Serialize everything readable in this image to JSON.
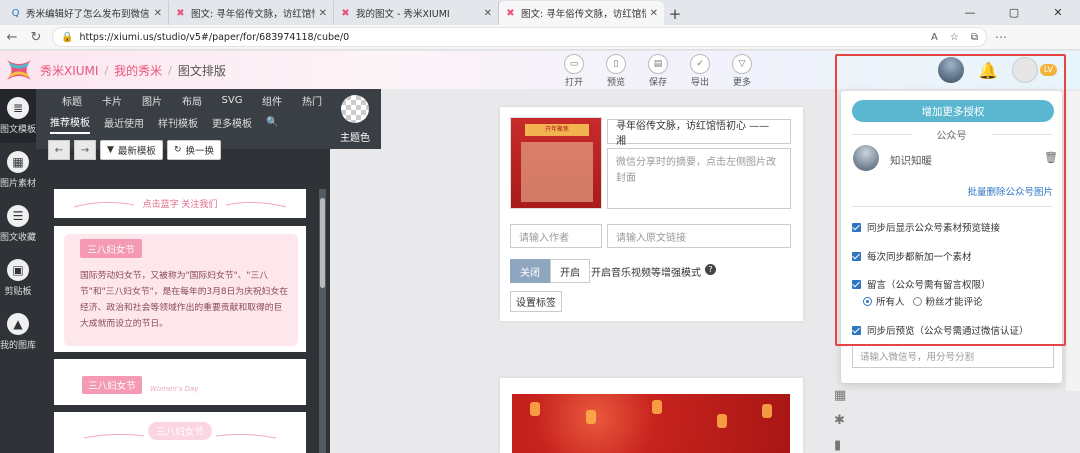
{
  "browser": {
    "tabs": [
      {
        "label": "秀米编辑好了怎么发布到微信公众号",
        "icon": "search-icon",
        "active": false
      },
      {
        "label": "图文: 寻年俗传文脉，访红馆悟初心",
        "icon": "xiumi-logo-icon",
        "active": false
      },
      {
        "label": "我的图文 - 秀米XIUMI",
        "icon": "xiumi-logo-icon",
        "active": false
      },
      {
        "label": "图文: 寻年俗传文脉，访红馆悟初心",
        "icon": "xiumi-logo-icon",
        "active": true
      }
    ],
    "url": "https://xiumi.us/studio/v5#/paper/for/683974118/cube/0"
  },
  "header": {
    "brand": "秀米XIUMI",
    "my_xiumi": "我的秀米",
    "page_name": "图文排版",
    "toolbar": [
      {
        "label": "打开",
        "icon": "open-icon"
      },
      {
        "label": "预览",
        "icon": "preview-icon"
      },
      {
        "label": "保存",
        "icon": "save-icon"
      },
      {
        "label": "导出",
        "icon": "export-icon"
      },
      {
        "label": "更多",
        "icon": "more-icon"
      }
    ],
    "level_badge": "LV"
  },
  "rail": [
    {
      "label": "图文模板",
      "icon": "template-icon",
      "active": true
    },
    {
      "label": "图片素材",
      "icon": "image-icon",
      "active": false
    },
    {
      "label": "图文收藏",
      "icon": "favorite-icon",
      "active": false
    },
    {
      "label": "剪贴板",
      "icon": "clipboard-icon",
      "active": false
    },
    {
      "label": "我的图库",
      "icon": "gallery-icon",
      "active": false
    }
  ],
  "panel": {
    "categories": [
      "标题",
      "卡片",
      "图片",
      "布局",
      "SVG",
      "组件",
      "热门"
    ],
    "sub_tabs": [
      "推荐模板",
      "最近使用",
      "样刊模板",
      "更多模板"
    ],
    "theme_color": "主题色",
    "new_templates": "最新模板",
    "shuffle": "换一换",
    "card1_text": "点击蓝字 关注我们",
    "card2_title": "三八妇女节",
    "card2_body": "国际劳动妇女节，又被称为\"国际妇女节\"、\"三八节\"和\"三八妇女节\"，是在每年的3月8日为庆祝妇女在经济、政治和社会等领域作出的重要贡献和取得的巨大成就而设立的节日。",
    "card3_title": "三八妇女节",
    "card3_sub": "Women's Day",
    "card4_title": "三八妇女节"
  },
  "editor": {
    "title": "寻年俗传文脉，访红馆悟初心 —— 湘",
    "digest_placeholder": "微信分享时的摘要，点击左侧图片改封面",
    "author_placeholder": "请输入作者",
    "link_placeholder": "请输入原文链接",
    "toggle_off": "关闭",
    "toggle_on": "开启",
    "music_label": "开启音乐视频等增强模式",
    "tag_button": "设置标签",
    "cover_text": "开年聚焦"
  },
  "dropdown": {
    "grant_button": "增加更多授权",
    "section_label": "公众号",
    "account_name": "知识知暖",
    "batch_delete": "批量删除公众号图片",
    "options": [
      {
        "label": "同步后显示公众号素材预览链接",
        "checked": true
      },
      {
        "label": "每次同步都新加一个素材",
        "checked": true
      },
      {
        "label": "留言（公众号需有留言权限）",
        "checked": true
      },
      {
        "label": "同步后预览（公众号需通过微信认证）",
        "checked": true
      }
    ],
    "radio_all": "所有人",
    "radio_fans": "粉丝才能评论",
    "wx_placeholder": "请输入微信号，用分号分割"
  },
  "colors": {
    "accent": "#e8557a",
    "highlight": "#e64545",
    "primary_blue": "#5ab7cf",
    "link_blue": "#2e76c2"
  }
}
